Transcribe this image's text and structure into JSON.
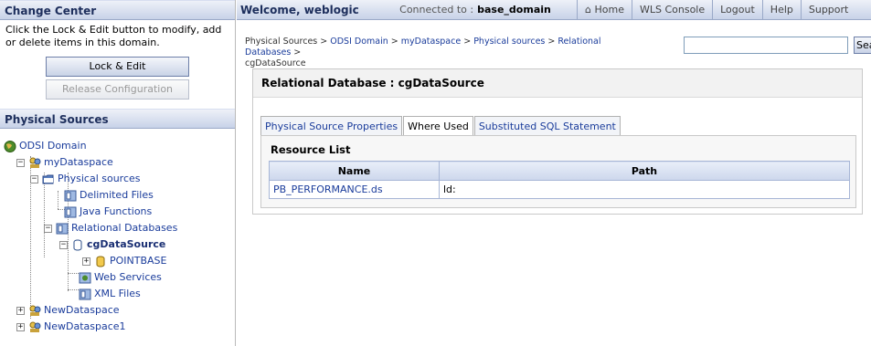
{
  "change_center": {
    "title": "Change Center",
    "message": "Click the Lock & Edit button to modify, add or delete items in this domain.",
    "lock_edit": "Lock & Edit",
    "release": "Release Configuration"
  },
  "physical_sources": {
    "title": "Physical Sources",
    "tree": {
      "domain": "ODSI Domain",
      "my_dataspace": "myDataspace",
      "physical_sources": "Physical sources",
      "delimited_files": "Delimited Files",
      "java_functions": "Java Functions",
      "relational_databases": "Relational Databases",
      "cg_datasource": "cgDataSource",
      "pointbase": "POINTBASE",
      "web_services": "Web Services",
      "xml_files": "XML Files",
      "new_dataspace": "NewDataspace",
      "new_dataspace1": "NewDataspace1"
    }
  },
  "topbar": {
    "welcome": "Welcome, weblogic",
    "connected_label": "Connected to :",
    "domain": "base_domain",
    "home": "Home",
    "wls_console": "WLS Console",
    "logout": "Logout",
    "help": "Help",
    "support": "Support"
  },
  "breadcrumb": {
    "items": [
      "Physical Sources",
      "ODSI Domain",
      "myDataspace",
      "Physical sources",
      "Relational Databases"
    ],
    "sep": " > ",
    "current": "cgDataSource"
  },
  "search": {
    "button": "Search",
    "value": ""
  },
  "main": {
    "title": "Relational Database : cgDataSource",
    "tabs": [
      "Physical Source Properties",
      "Where Used",
      "Substituted SQL Statement"
    ],
    "active_tab": 1,
    "resource_list_title": "Resource List",
    "columns": [
      "Name",
      "Path"
    ],
    "rows": [
      {
        "name": "PB_PERFORMANCE.ds",
        "path": "ld:"
      }
    ]
  }
}
